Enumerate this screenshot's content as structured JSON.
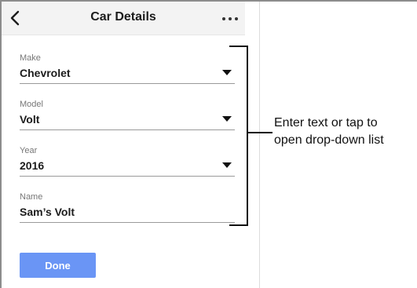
{
  "header": {
    "title": "Car Details",
    "back_icon": "chevron-left-icon",
    "more_icon": "more-horizontal-icon"
  },
  "form": {
    "fields": [
      {
        "label": "Make",
        "value": "Chevrolet",
        "type": "dropdown"
      },
      {
        "label": "Model",
        "value": "Volt",
        "type": "dropdown"
      },
      {
        "label": "Year",
        "value": "2016",
        "type": "dropdown"
      },
      {
        "label": "Name",
        "value": "Sam’s Volt",
        "type": "text"
      }
    ],
    "done_label": "Done"
  },
  "annotation": {
    "line1": "Enter text or tap to",
    "line2": "open drop-down list"
  },
  "colors": {
    "button": "#6a95f5",
    "header_bg": "#f3f3f3"
  }
}
